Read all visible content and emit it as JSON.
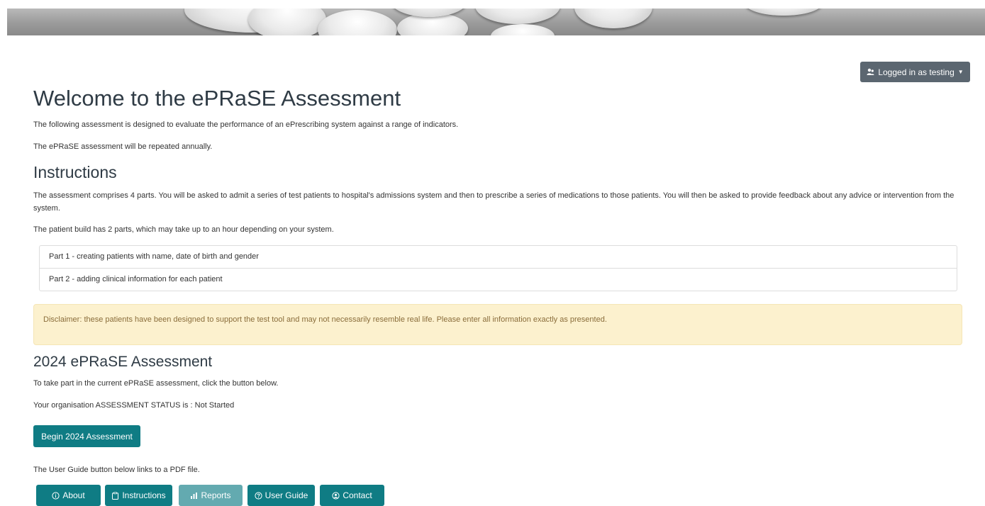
{
  "header": {
    "login_label": "Logged in as testing",
    "login_icon": "user-icon"
  },
  "intro": {
    "title": "Welcome to the ePRaSE Assessment",
    "line1": "The following assessment is designed to evaluate the performance of an ePrescribing system against a range of indicators.",
    "line2": "The ePRaSE assessment will be repeated annually."
  },
  "instructions": {
    "heading": "Instructions",
    "paragraph": "The assessment comprises 4 parts. You will be asked to admit a series of test patients to hospital's admissions system and then to prescribe a series of medications to those patients. You will then be asked to provide feedback about any advice or intervention from the system.",
    "patient_build": "The patient build has 2 parts, which may take up to an hour depending on your system.",
    "parts": [
      "Part 1 - creating patients with name, date of birth and gender",
      "Part 2 - adding clinical information for each patient"
    ]
  },
  "disclaimer": "Disclaimer: these patients have been designed to support the test tool and may not necessarily resemble real life. Please enter all information exactly as presented.",
  "assessment": {
    "heading": "2024 ePRaSE Assessment",
    "take_part": "To take part in the current ePRaSE assessment, click the button below.",
    "status": "Your organisation ASSESSMENT STATUS is : Not Started",
    "begin_label": "Begin 2024 Assessment",
    "guide_note": "The User Guide button below links to a PDF file."
  },
  "nav": {
    "about": "About",
    "instructions": "Instructions",
    "reports": "Reports",
    "user_guide": "User Guide",
    "contact": "Contact"
  },
  "colors": {
    "teal": "#0f7c84",
    "teal_disabled": "#63aab0",
    "login_grey": "#5b6670",
    "disclaimer_bg": "#fcf1ce"
  }
}
